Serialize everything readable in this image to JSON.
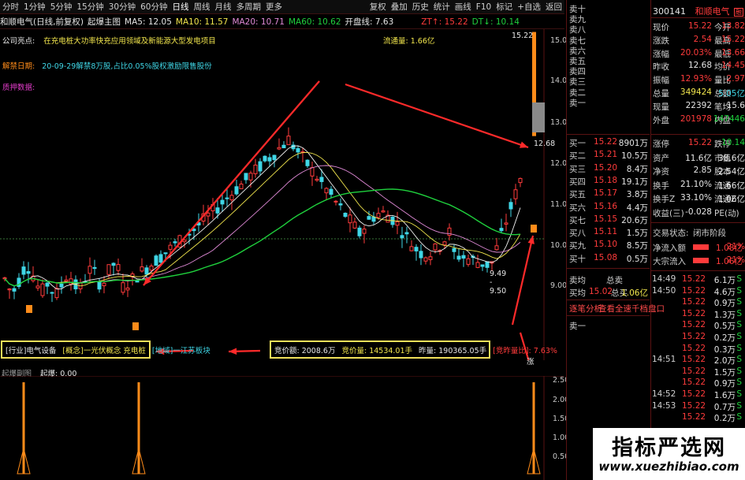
{
  "toolbar": {
    "periods": [
      "分时",
      "1分钟",
      "5分钟",
      "15分钟",
      "30分钟",
      "60分钟",
      "日线",
      "周线",
      "月线",
      "多周期",
      "更多"
    ],
    "right": [
      "复权",
      "叠加",
      "历史",
      "统计",
      "画线",
      "F10",
      "标记",
      "+自选",
      "返回"
    ]
  },
  "info": {
    "name": "和顺电气(日线,前复权)",
    "indicator": "起爆主图",
    "ma5": "MA5: 12.05",
    "ma10": "MA10: 11.57",
    "ma20": "MA20: 10.71",
    "ma60": "MA60: 10.62",
    "open": "开盘线: 7.63",
    "zt": "ZT↑: 15.22",
    "dt": "DT↓: 10.14"
  },
  "notes": {
    "highlight_label": "公司亮点:",
    "highlight_text": "在充电桩大功率快充应用领域及新能源大型发电项目",
    "float_cap": "流通量: 1.66亿",
    "unlock_label": "解禁日期:",
    "unlock_text": "20-09-29解禁8万股,占比0.05%股权激励限售股份",
    "pledge_label": "质押数据:"
  },
  "chart": {
    "price_ticks": [
      "15.00",
      "14.00",
      "13.00",
      "12.00",
      "11.00",
      "10.00",
      "9.00"
    ],
    "sub_ticks": [
      "2.50",
      "2.00",
      "1.50",
      "1.00",
      "0.50"
    ],
    "high_label": "15.22",
    "mid_label": "12.68",
    "low_label": "9.49 - 9.50",
    "signal_label": "起爆",
    "zhang_label": "涨",
    "sub_title": "起爆副图",
    "sub_value": "起爆: 0.00"
  },
  "boxes": {
    "left": [
      "[行业]电气设备",
      "[概念]一光伏概念 充电桩",
      "[地域]一江苏板块"
    ],
    "right": [
      "竞价额: 2008.6万",
      "竞价量: 14534.01手",
      "昨量: 190365.05手",
      "[竞昨量比]: 7.63%"
    ]
  },
  "stock": {
    "code": "300141",
    "name": "和顺电气",
    "tag": "融"
  },
  "asks": [
    {
      "label": "卖十",
      "price": "",
      "vol": ""
    },
    {
      "label": "卖九",
      "price": "",
      "vol": ""
    },
    {
      "label": "卖八",
      "price": "",
      "vol": ""
    },
    {
      "label": "卖七",
      "price": "",
      "vol": ""
    },
    {
      "label": "卖六",
      "price": "",
      "vol": ""
    },
    {
      "label": "卖五",
      "price": "",
      "vol": ""
    },
    {
      "label": "卖四",
      "price": "",
      "vol": ""
    },
    {
      "label": "卖三",
      "price": "",
      "vol": ""
    },
    {
      "label": "卖二",
      "price": "",
      "vol": ""
    },
    {
      "label": "卖一",
      "price": "",
      "vol": ""
    }
  ],
  "bids": [
    {
      "label": "买一",
      "price": "15.22",
      "vol": "8901万"
    },
    {
      "label": "买二",
      "price": "15.21",
      "vol": "10.5万"
    },
    {
      "label": "买三",
      "price": "15.20",
      "vol": "8.4万"
    },
    {
      "label": "买四",
      "price": "15.18",
      "vol": "19.1万"
    },
    {
      "label": "买五",
      "price": "15.17",
      "vol": "3.8万"
    },
    {
      "label": "买六",
      "price": "15.16",
      "vol": "4.4万"
    },
    {
      "label": "买七",
      "price": "15.15",
      "vol": "20.6万"
    },
    {
      "label": "买八",
      "price": "15.11",
      "vol": "1.5万"
    },
    {
      "label": "买九",
      "price": "15.10",
      "vol": "8.5万"
    },
    {
      "label": "买十",
      "price": "15.08",
      "vol": "0.5万"
    }
  ],
  "avg": {
    "sell_label": "卖均",
    "sell_total_label": "总卖",
    "buy_label": "买均",
    "buy_price": "15.02",
    "buy_total_label": "总买",
    "buy_total": "1.06亿"
  },
  "links": {
    "ticks": "逐笔分析",
    "full": "查看全速千档盘口"
  },
  "extra_ask": "卖一",
  "quote_top": [
    {
      "k1": "现价",
      "v1": "15.22",
      "c1": "red",
      "k2": "今开",
      "v2": "13.82",
      "c2": "red"
    },
    {
      "k1": "涨跌",
      "v1": "2.54",
      "c1": "red",
      "k2": "最高",
      "v2": "15.22",
      "c2": "red"
    },
    {
      "k1": "涨幅",
      "v1": "20.03%",
      "c1": "red",
      "k2": "最低",
      "v2": "13.66",
      "c2": "red"
    },
    {
      "k1": "昨收",
      "v1": "12.68",
      "c1": "white",
      "k2": "均价",
      "v2": "14.45",
      "c2": "red"
    },
    {
      "k1": "振幅",
      "v1": "12.93%",
      "c1": "red",
      "k2": "量比",
      "v2": "2.97",
      "c2": "red"
    },
    {
      "k1": "总量",
      "v1": "349424",
      "c1": "yellow",
      "k2": "总额",
      "v2": "5.05亿",
      "c2": "cyan"
    },
    {
      "k1": "现量",
      "v1": "22392",
      "c1": "white",
      "k2": "笔均",
      "v2": "15.6",
      "c2": "white"
    },
    {
      "k1": "外盘",
      "v1": "201978",
      "c1": "red",
      "k2": "内盘",
      "v2": "147446",
      "c2": "green"
    }
  ],
  "quote_bottom": [
    {
      "k1": "涨停",
      "v1": "15.22",
      "c1": "red",
      "k2": "跌停",
      "v2": "10.14",
      "c2": "green"
    },
    {
      "k1": "资产",
      "v1": "11.6亿",
      "c1": "white",
      "k2": "市值",
      "v2": "38.6亿",
      "c2": "white"
    },
    {
      "k1": "净资",
      "v1": "2.85",
      "c1": "white",
      "k2": "股本",
      "v2": "2.54亿",
      "c2": "white"
    },
    {
      "k1": "换手",
      "v1": "21.10%",
      "c1": "white",
      "k2": "流通",
      "v2": "1.66亿",
      "c2": "white"
    },
    {
      "k1": "换手Z",
      "v1": "33.10%",
      "c1": "white",
      "k2": "流通Z",
      "v2": "1.06亿",
      "c2": "white"
    },
    {
      "k1": "收益(三)",
      "v1": "-0.028",
      "c1": "white",
      "k2": "PE(动)",
      "v2": "",
      "c2": "white"
    }
  ],
  "trade_state": {
    "label": "交易状态:",
    "value": "闭市阶段"
  },
  "flows": [
    {
      "label": "净流入额",
      "value": "1.08亿",
      "pct": "21%",
      "fill": 0.9
    },
    {
      "label": "大宗流入",
      "value": "1.06亿",
      "pct": "21%",
      "fill": 0.9
    }
  ],
  "ticks": [
    {
      "t": "14:49",
      "p": "15.22",
      "v": "6.1万",
      "d": "S"
    },
    {
      "t": "14:50",
      "p": "15.22",
      "v": "4.6万",
      "d": "S"
    },
    {
      "t": "",
      "p": "15.22",
      "v": "0.9万",
      "d": "S"
    },
    {
      "t": "",
      "p": "15.22",
      "v": "1.3万",
      "d": "S"
    },
    {
      "t": "",
      "p": "15.22",
      "v": "0.5万",
      "d": "S"
    },
    {
      "t": "",
      "p": "15.22",
      "v": "0.2万",
      "d": "S"
    },
    {
      "t": "",
      "p": "15.22",
      "v": "0.3万",
      "d": "S"
    },
    {
      "t": "14:51",
      "p": "15.22",
      "v": "2.0万",
      "d": "S"
    },
    {
      "t": "",
      "p": "15.22",
      "v": "1.5万",
      "d": "S"
    },
    {
      "t": "",
      "p": "15.22",
      "v": "0.9万",
      "d": "S"
    },
    {
      "t": "14:52",
      "p": "15.22",
      "v": "1.6万",
      "d": "S"
    },
    {
      "t": "14:53",
      "p": "15.22",
      "v": "0.7万",
      "d": "S"
    },
    {
      "t": "",
      "p": "15.22",
      "v": "0.2万",
      "d": "S"
    }
  ],
  "watermark": {
    "cn": "指标严选网",
    "url": "www.xuezhibiao.com"
  }
}
